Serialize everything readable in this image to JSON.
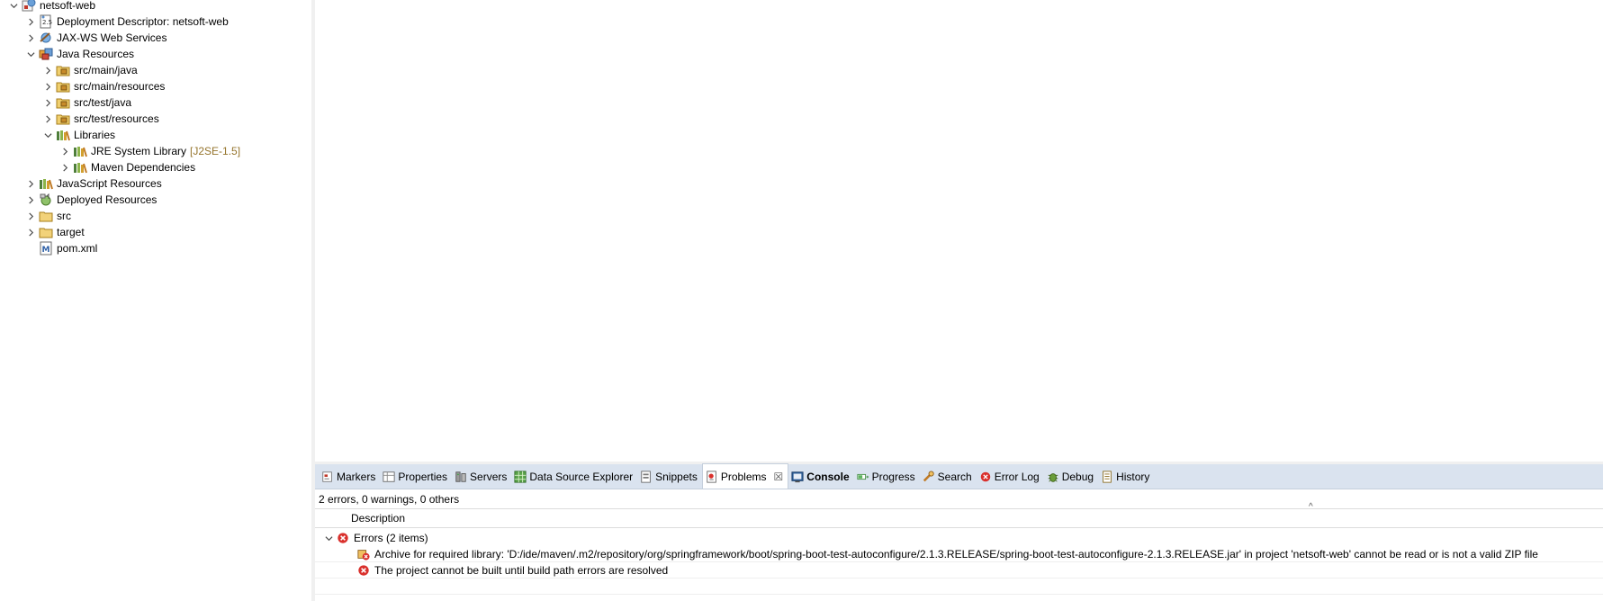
{
  "explorer": {
    "items": [
      {
        "label": "netsoft-web",
        "decor": "",
        "depth": 0,
        "expanded": true,
        "icon": "web-project-icon"
      },
      {
        "label": "Deployment Descriptor: netsoft-web",
        "decor": "",
        "depth": 1,
        "expanded": false,
        "icon": "deployment-descriptor-icon"
      },
      {
        "label": "JAX-WS Web Services",
        "decor": "",
        "depth": 1,
        "expanded": false,
        "icon": "web-services-icon"
      },
      {
        "label": "Java Resources",
        "decor": "",
        "depth": 1,
        "expanded": true,
        "icon": "java-resources-icon"
      },
      {
        "label": "src/main/java",
        "decor": "",
        "depth": 2,
        "expanded": false,
        "icon": "source-folder-icon"
      },
      {
        "label": "src/main/resources",
        "decor": "",
        "depth": 2,
        "expanded": false,
        "icon": "source-folder-icon"
      },
      {
        "label": "src/test/java",
        "decor": "",
        "depth": 2,
        "expanded": false,
        "icon": "source-folder-icon"
      },
      {
        "label": "src/test/resources",
        "decor": "",
        "depth": 2,
        "expanded": false,
        "icon": "source-folder-icon"
      },
      {
        "label": "Libraries",
        "decor": "",
        "depth": 2,
        "expanded": true,
        "icon": "library-icon"
      },
      {
        "label": "JRE System Library",
        "decor": "[J2SE-1.5]",
        "depth": 3,
        "expanded": false,
        "icon": "library-icon"
      },
      {
        "label": "Maven Dependencies",
        "decor": "",
        "depth": 3,
        "expanded": false,
        "icon": "library-icon"
      },
      {
        "label": "JavaScript Resources",
        "decor": "",
        "depth": 1,
        "expanded": false,
        "icon": "library-icon"
      },
      {
        "label": "Deployed Resources",
        "decor": "",
        "depth": 1,
        "expanded": false,
        "icon": "deployed-resources-icon"
      },
      {
        "label": "src",
        "decor": "",
        "depth": 1,
        "expanded": false,
        "icon": "folder-icon"
      },
      {
        "label": "target",
        "decor": "",
        "depth": 1,
        "expanded": false,
        "icon": "folder-icon"
      },
      {
        "label": "pom.xml",
        "decor": "",
        "depth": 1,
        "expanded": null,
        "icon": "maven-pom-icon"
      }
    ]
  },
  "panel": {
    "tabs": [
      {
        "label": "Markers",
        "icon": "markers-icon",
        "active": false,
        "bold": false
      },
      {
        "label": "Properties",
        "icon": "properties-icon",
        "active": false,
        "bold": false
      },
      {
        "label": "Servers",
        "icon": "servers-icon",
        "active": false,
        "bold": false
      },
      {
        "label": "Data Source Explorer",
        "icon": "data-source-icon",
        "active": false,
        "bold": false
      },
      {
        "label": "Snippets",
        "icon": "snippets-icon",
        "active": false,
        "bold": false
      },
      {
        "label": "Problems",
        "icon": "problems-icon",
        "active": true,
        "bold": false,
        "close": "☒"
      },
      {
        "label": "Console",
        "icon": "console-icon",
        "active": false,
        "bold": true
      },
      {
        "label": "Progress",
        "icon": "progress-icon",
        "active": false,
        "bold": false
      },
      {
        "label": "Search",
        "icon": "search-icon",
        "active": false,
        "bold": false
      },
      {
        "label": "Error Log",
        "icon": "error-log-icon",
        "active": false,
        "bold": false
      },
      {
        "label": "Debug",
        "icon": "debug-icon",
        "active": false,
        "bold": false
      },
      {
        "label": "History",
        "icon": "history-icon",
        "active": false,
        "bold": false
      }
    ],
    "summary": "2 errors, 0 warnings, 0 others",
    "column_description": "Description",
    "sort_caret": "^",
    "group": {
      "label": "Errors (2 items)"
    },
    "problems": [
      {
        "text": "Archive for required library: 'D:/ide/maven/.m2/repository/org/springframework/boot/spring-boot-test-autoconfigure/2.1.3.RELEASE/spring-boot-test-autoconfigure-2.1.3.RELEASE.jar' in project 'netsoft-web' cannot be read or is not a valid ZIP file",
        "icon": "build-path-error-icon"
      },
      {
        "text": "The project cannot be built until build path errors are resolved",
        "icon": "error-icon"
      }
    ]
  },
  "colors": {
    "tabbar_bg": "#dae3ef",
    "error_red": "#d9302c",
    "decor_brown": "#95742c",
    "folder_yellow": "#e8c15a"
  }
}
